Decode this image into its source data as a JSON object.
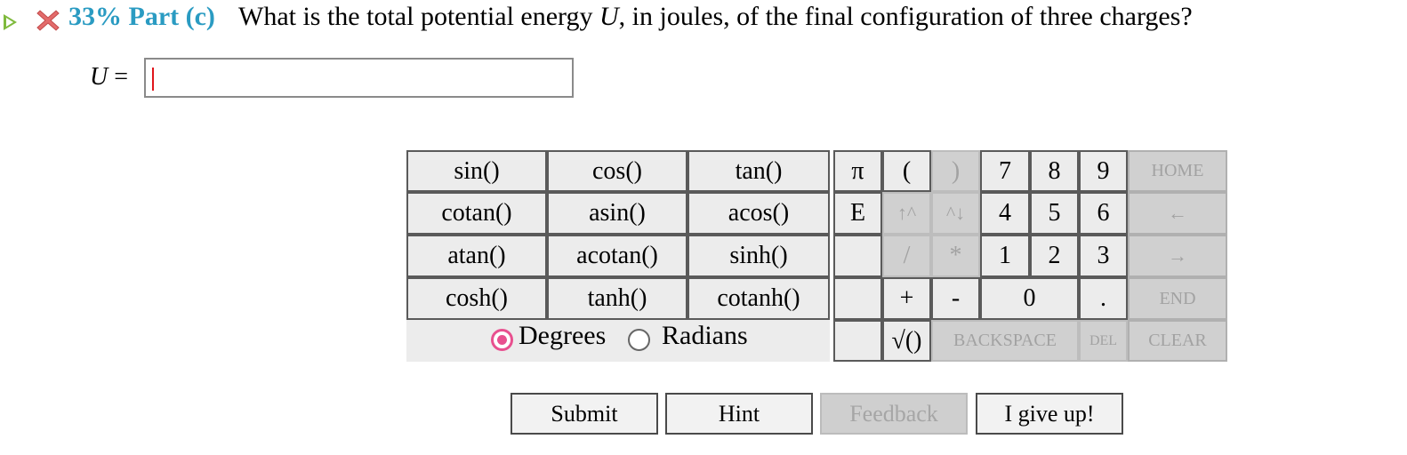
{
  "header": {
    "part_label": "33% Part (c)",
    "question": "What is the total potential energy U, in joules, of the final configuration of three charges?"
  },
  "answer": {
    "variable": "U",
    "equals": "=",
    "value": ""
  },
  "keypad": {
    "functions": [
      [
        "sin()",
        "cos()",
        "tan()"
      ],
      [
        "cotan()",
        "asin()",
        "acos()"
      ],
      [
        "atan()",
        "acotan()",
        "sinh()"
      ],
      [
        "cosh()",
        "tanh()",
        "cotanh()"
      ]
    ],
    "pi": "π",
    "e": "E",
    "open_paren": "(",
    "close_paren": ")",
    "up_caret": "↑^",
    "down_caret": "^↓",
    "divide": "/",
    "multiply": "*",
    "plus": "+",
    "minus": "-",
    "sqrt": "√()",
    "digits": [
      "7",
      "8",
      "9",
      "4",
      "5",
      "6",
      "1",
      "2",
      "3",
      "0",
      "."
    ],
    "home": "HOME",
    "left_arrow": "←",
    "right_arrow": "→",
    "end": "END",
    "backspace": "BACKSPACE",
    "del": "DEL",
    "clear": "CLEAR",
    "mode": {
      "options": [
        "Degrees",
        "Radians"
      ],
      "selected": "Degrees"
    }
  },
  "actions": {
    "submit": "Submit",
    "hint": "Hint",
    "feedback": "Feedback",
    "give_up": "I give up!"
  },
  "colors": {
    "part_label": "#2a9bc2",
    "status_wrong": "#e36b6b",
    "play_arrow": "#7fba3d",
    "radio_selected": "#e8508f",
    "caret": "#e0161c"
  }
}
